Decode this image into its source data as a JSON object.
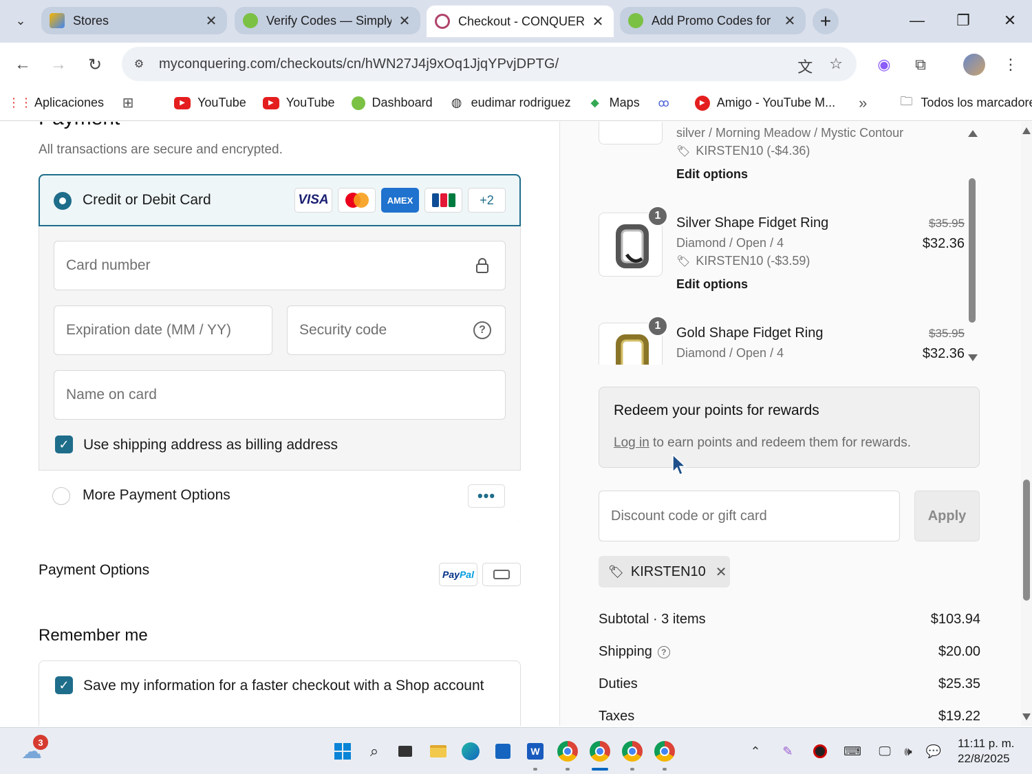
{
  "browser": {
    "tabs": [
      {
        "title": "Stores",
        "active": false
      },
      {
        "title": "Verify Codes — Simply",
        "active": false
      },
      {
        "title": "Checkout - CONQUERI",
        "active": true
      },
      {
        "title": "Add Promo Codes for",
        "active": false
      }
    ],
    "url": "myconquering.com/checkouts/cn/hWN27J4j9xOq1JjqYPvjDPTG/",
    "bookmarks": [
      {
        "label": "Aplicaciones",
        "icon": "apps-grid-icon"
      },
      {
        "label": "YouTube",
        "icon": "youtube-icon"
      },
      {
        "label": "YouTube",
        "icon": "youtube-icon"
      },
      {
        "label": "Dashboard",
        "icon": "dashboard-icon"
      },
      {
        "label": "eudimar rodriguez",
        "icon": "globe-icon"
      },
      {
        "label": "Maps",
        "icon": "maps-icon"
      },
      {
        "label": "Amigo - YouTube M...",
        "icon": "youtube-music-icon"
      }
    ],
    "all_bookmarks": "Todos los marcadores",
    "overflow": "»"
  },
  "payment": {
    "heading": "Payment",
    "subtitle": "All transactions are secure and encrypted.",
    "method_card": "Credit or Debit Card",
    "card_brands": [
      "VISA",
      "AMEX",
      "+2"
    ],
    "card_number_placeholder": "Card number",
    "expiry_placeholder": "Expiration date (MM / YY)",
    "security_placeholder": "Security code",
    "name_placeholder": "Name on card",
    "billing_same_label": "Use shipping address as billing address",
    "billing_same_checked": true,
    "more_options": "More Payment Options",
    "payment_options_title": "Payment Options",
    "paypal_text_a": "Pay",
    "paypal_text_b": "Pal",
    "remember_title": "Remember me",
    "save_info_label": "Save my information for a faster checkout with a Shop account",
    "save_info_checked": true
  },
  "order": {
    "lines": [
      {
        "title": "",
        "variant": "silver / Morning Meadow / Mystic Contour",
        "discount": "KIRSTEN10 (-$4.36)",
        "edit": "Edit options",
        "qty": "",
        "price_old": "",
        "price_new": ""
      },
      {
        "title": "Silver Shape Fidget Ring",
        "variant": "Diamond / Open / 4",
        "discount": "KIRSTEN10 (-$3.59)",
        "edit": "Edit options",
        "qty": "1",
        "price_old": "$35.95",
        "price_new": "$32.36"
      },
      {
        "title": "Gold Shape Fidget Ring",
        "variant": "Diamond / Open / 4",
        "discount": "",
        "edit": "",
        "qty": "1",
        "price_old": "$35.95",
        "price_new": "$32.36"
      }
    ],
    "rewards_title": "Redeem your points for rewards",
    "rewards_link": "Log in",
    "rewards_text": " to earn points and redeem them for rewards.",
    "discount_placeholder": "Discount code or gift card",
    "apply_label": "Apply",
    "applied_code": "KIRSTEN10",
    "summary": [
      {
        "label": "Subtotal · 3 items",
        "value": "$103.94",
        "help": false
      },
      {
        "label": "Shipping",
        "value": "$20.00",
        "help": true
      },
      {
        "label": "Duties",
        "value": "$25.35",
        "help": false
      },
      {
        "label": "Taxes",
        "value": "$19.22",
        "help": false
      }
    ]
  },
  "taskbar": {
    "weather_badge": "3",
    "time": "11:11 p. m.",
    "date": "22/8/2025"
  },
  "colors": {
    "accent": "#1e6d8a",
    "tabstrip": "#dbe1ec"
  }
}
